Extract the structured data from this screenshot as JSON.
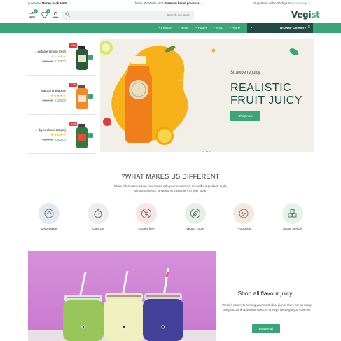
{
  "topbar": {
    "left_prefix": "guarantee",
    "left_bold": "Money back 100%",
    "center_prefix": "for an affordable price",
    "center_bold": "Premium brand products",
    "right_prefix": "of products within 30 days",
    "right_green": "Free exchange"
  },
  "header": {
    "compare_count": "0",
    "wishlist_count": "0",
    "search_placeholder": "Search our store",
    "logo_text": "Vegi",
    "logo_accent": "st"
  },
  "nav": {
    "items": [
      "Feature",
      "Blogs",
      "Pages",
      "Shop",
      "Home"
    ],
    "browse_label": "Browse category"
  },
  "products": [
    {
      "name": "...getable tomato fresh",
      "rating": 5,
      "old_price": "€145.00",
      "price": "€103.00",
      "discount": "-15%",
      "color": "#2d5a3a"
    },
    {
      "name": "Natural grabapear",
      "rating": 5,
      "old_price": "€160.00",
      "price": "€109.00",
      "discount": "-17%",
      "color": "#f08a2a"
    },
    {
      "name": "... dryed almod (50gm)",
      "rating": 5,
      "old_price": "€550.00",
      "price": "€383.00",
      "discount": "-11%",
      "color": "#2f7a3c"
    }
  ],
  "hero": {
    "subtitle": "Strawberry juicy",
    "title_line1": "REALISTIC",
    "title_line2": "FRUIT JUICY",
    "button": "Shop now",
    "slides": 3,
    "active_slide": 2
  },
  "features": {
    "title": "?WHAT MAKES US DIFFERENT",
    "description": "Share information about your brand with your customers. Describe a product, make announcements, or welcome customers to your store.",
    "items": [
      {
        "label": "Zero waste",
        "icon": "recycle-icon",
        "bg": "#e3e9f3"
      },
      {
        "label": "Cals 18",
        "icon": "leaf-stopwatch-icon",
        "bg": "#eeeeee"
      },
      {
        "label": "Gluten-free",
        "icon": "gluten-free-icon",
        "bg": "#f6e6e6"
      },
      {
        "label": "Vegan 100%",
        "icon": "vegan-leaf-icon",
        "bg": "#e6efe8"
      },
      {
        "label": "Probiotics",
        "icon": "probiotics-icon",
        "bg": "#f2e9e1"
      },
      {
        "label": "Sugar friendly",
        "icon": "sugar-cubes-icon",
        "bg": "#e6f2e8"
      }
    ]
  },
  "banner": {
    "title": "Shop all flavour juicy",
    "description": "When it comes to hosting your most ideal picnic, there are so many things to think about from sauces to trays, we've got you covered",
    "button": "Browse all"
  },
  "colors": {
    "accent": "#3aa677",
    "dark": "#234a43",
    "heading": "#1d4d4a"
  }
}
